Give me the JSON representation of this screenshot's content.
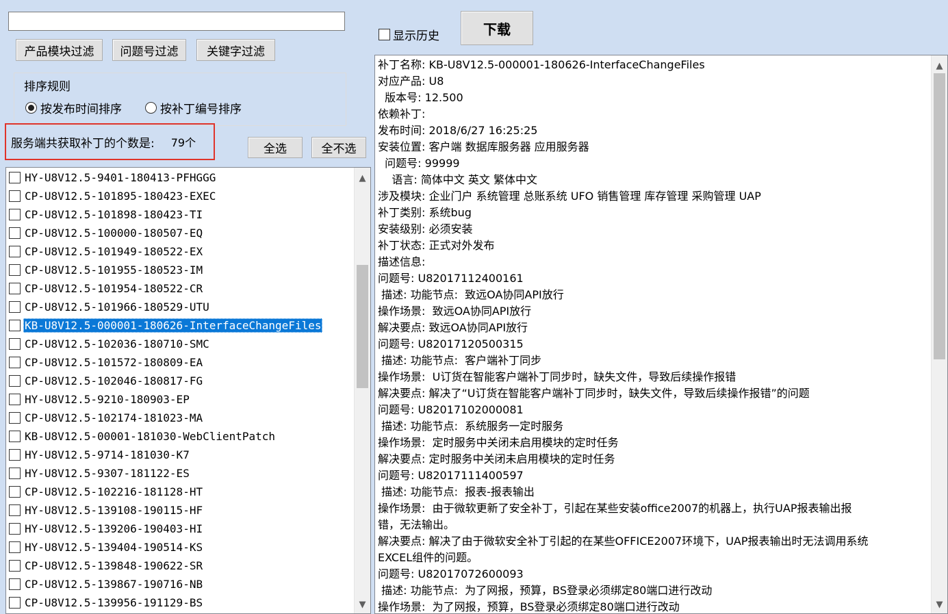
{
  "search": {
    "value": "",
    "placeholder": ""
  },
  "filters": {
    "product_module": "产品模块过滤",
    "issue_no": "问题号过滤",
    "keyword": "关键字过滤"
  },
  "sort": {
    "title": "排序规则",
    "options": [
      {
        "label": "按发布时间排序",
        "selected": true
      },
      {
        "label": "按补丁编号排序",
        "selected": false
      }
    ]
  },
  "count": {
    "label": "服务端共获取补丁的个数是:",
    "value": "79个"
  },
  "buttons": {
    "select_all": "全选",
    "select_none": "全不选",
    "download": "下载"
  },
  "show_history": {
    "label": "显示历史",
    "checked": false
  },
  "patch_list": {
    "selected_index": 8,
    "items": [
      "HY-U8V12.5-9401-180413-PFHGGG",
      "CP-U8V12.5-101895-180423-EXEC",
      "CP-U8V12.5-101898-180423-TI",
      "CP-U8V12.5-100000-180507-EQ",
      "CP-U8V12.5-101949-180522-EX",
      "CP-U8V12.5-101955-180523-IM",
      "CP-U8V12.5-101954-180522-CR",
      "CP-U8V12.5-101966-180529-UTU",
      "KB-U8V12.5-000001-180626-InterfaceChangeFiles",
      "CP-U8V12.5-102036-180710-SMC",
      "CP-U8V12.5-101572-180809-EA",
      "CP-U8V12.5-102046-180817-FG",
      "HY-U8V12.5-9210-180903-EP",
      "CP-U8V12.5-102174-181023-MA",
      "KB-U8V12.5-00001-181030-WebClientPatch",
      "HY-U8V12.5-9714-181030-K7",
      "HY-U8V12.5-9307-181122-ES",
      "CP-U8V12.5-102216-181128-HT",
      "HY-U8V12.5-139108-190115-HF",
      "HY-U8V12.5-139206-190403-HI",
      "HY-U8V12.5-139404-190514-KS",
      "CP-U8V12.5-139848-190622-SR",
      "CP-U8V12.5-139867-190716-NB",
      "CP-U8V12.5-139956-191129-BS"
    ]
  },
  "details": {
    "lines": [
      "补丁名称: KB-U8V12.5-000001-180626-InterfaceChangeFiles",
      "对应产品: U8",
      "  版本号: 12.500",
      "依赖补丁:",
      "发布时间: 2018/6/27 16:25:25",
      "安装位置: 客户端 数据库服务器 应用服务器",
      "  问题号: 99999",
      "    语言: 简体中文 英文 繁体中文",
      "涉及模块: 企业门户 系统管理 总账系统 UFO 销售管理 库存管理 采购管理 UAP",
      "补丁类别: 系统bug",
      "安装级别: 必须安装",
      "补丁状态: 正式对外发布",
      "描述信息:",
      "问题号: U82017112400161",
      " 描述: 功能节点:  致远OA协同API放行",
      "操作场景:  致远OA协同API放行",
      "解决要点: 致远OA协同API放行",
      "问题号: U82017120500315",
      " 描述: 功能节点:  客户端补丁同步",
      "操作场景:  U订货在智能客户端补丁同步时，缺失文件，导致后续操作报错",
      "解决要点: 解决了“U订货在智能客户端补丁同步时，缺失文件，导致后续操作报错”的问题",
      "问题号: U82017102000081",
      " 描述: 功能节点:  系统服务一定时服务",
      "操作场景:  定时服务中关闭未启用模块的定时任务",
      "解决要点: 定时服务中关闭未启用模块的定时任务",
      "问题号: U82017111400597",
      " 描述: 功能节点:  报表-报表输出",
      "操作场景:  由于微软更新了安全补丁，引起在某些安装office2007的机器上，执行UAP报表输出报",
      "错，无法输出。",
      "解决要点: 解决了由于微软安全补丁引起的在某些OFFICE2007环境下，UAP报表输出时无法调用系统",
      "EXCEL组件的问题。",
      "问题号: U82017072600093",
      " 描述: 功能节点:  为了网报，预算，BS登录必须绑定80端口进行改动",
      "操作场景:  为了网报，预算，BS登录必须绑定80端口进行改动"
    ]
  },
  "icons": {
    "scroll_up": "chevron-up-icon",
    "scroll_down": "chevron-down-icon"
  }
}
